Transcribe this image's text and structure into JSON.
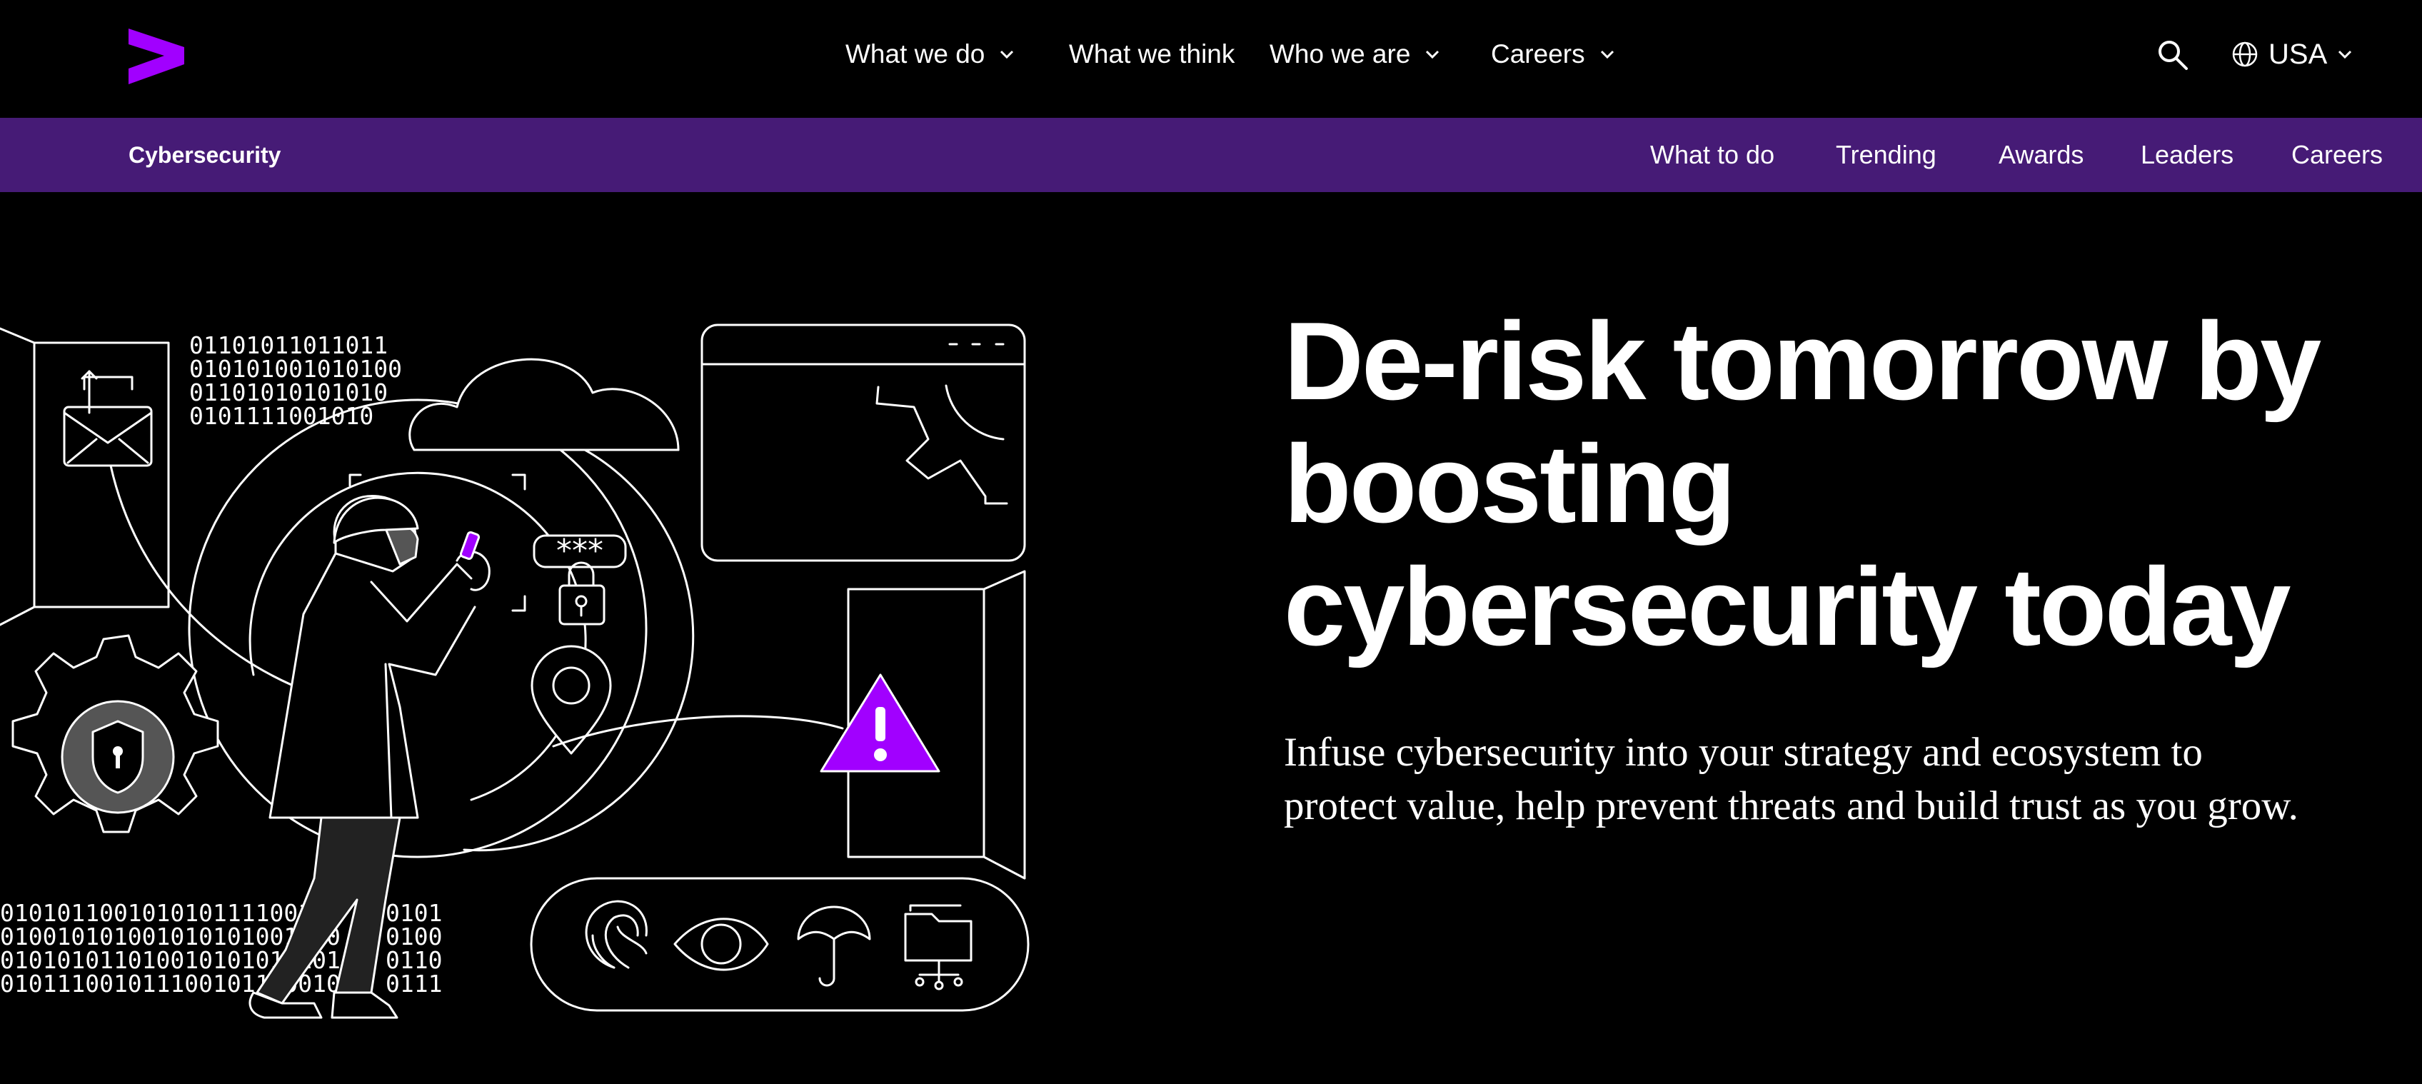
{
  "brand": {
    "accent": "#a100ff",
    "subnav_bg": "#461b76"
  },
  "topnav": {
    "logo": "accenture-chevron-logo",
    "items": [
      {
        "label": "What we do",
        "has_dropdown": true
      },
      {
        "label": "What we think",
        "has_dropdown": false
      },
      {
        "label": "Who we are",
        "has_dropdown": true
      },
      {
        "label": "Careers",
        "has_dropdown": true
      }
    ],
    "search_icon": "search-icon",
    "language": {
      "icon": "globe-icon",
      "label": "USA"
    }
  },
  "subnav": {
    "title": "Cybersecurity",
    "items": [
      {
        "label": "What to do"
      },
      {
        "label": "Trending"
      },
      {
        "label": "Awards"
      },
      {
        "label": "Leaders"
      },
      {
        "label": "Careers"
      }
    ]
  },
  "hero": {
    "headline": "De-risk tomorrow by boosting cybersecurity today",
    "subtext": "Infuse cybersecurity into your strategy and ecosystem to protect value, help prevent threats and build trust as you grow.",
    "illustration": {
      "binary_top": [
        "01101011011011",
        "010101001010100",
        "01101010101010",
        "0101111001010"
      ],
      "binary_bottom": [
        "01010110010101011110010",
        "010010101001010101001010",
        "010101011010010101011101",
        "010111001011100101110010"
      ],
      "binary_right": [
        "0101",
        "0100",
        "0110",
        "0111"
      ],
      "password": "***",
      "icons": [
        "envelope-upload-icon",
        "shield-gear-icon",
        "cloud-icon",
        "padlock-icon",
        "location-pin-icon",
        "warning-icon",
        "fingerprint-icon",
        "eye-icon",
        "umbrella-icon",
        "folder-network-icon"
      ]
    }
  }
}
